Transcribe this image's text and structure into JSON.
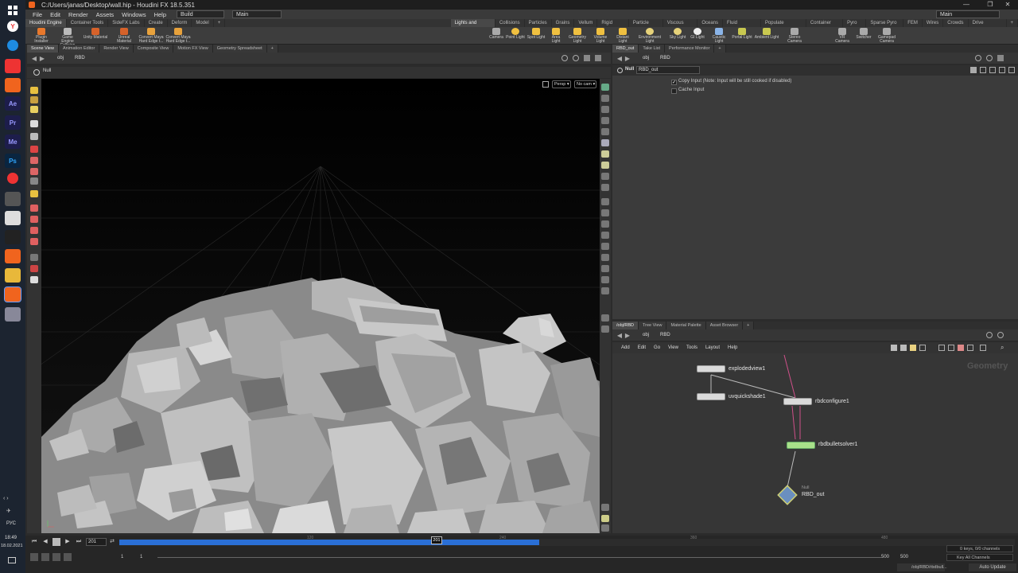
{
  "window": {
    "title": "C:/Users/janas/Desktop/wall.hip - Houdini FX 18.5.351"
  },
  "menubar": {
    "items": [
      "File",
      "Edit",
      "Render",
      "Assets",
      "Windows",
      "Help"
    ],
    "desktop_dropdown": "Build",
    "right_dropdown": "Main",
    "right_dropdown2": "Main"
  },
  "shelf_tabs_left": [
    "Houdini Engine",
    "Container Tools",
    "SideFX Labs",
    "Create",
    "Deform",
    "Model"
  ],
  "shelf_tabs_right": [
    "Lights and Cameras",
    "Collisions",
    "Particles",
    "Grains",
    "Vellum",
    "Rigid Bodies",
    "Particle Fluids",
    "Viscous Fluids",
    "Oceans",
    "Fluid Containers",
    "Populate Containers",
    "Container Tools",
    "Pyro FX",
    "Sparse Pyro FX",
    "FEM",
    "Wires",
    "Crowds",
    "Drive Simulation"
  ],
  "shelf_tools_left": [
    "Plugin Installer",
    "Game Engine Collision",
    "Unity Material",
    "Unreal Material",
    "Convert Maya Hard Edge t...",
    "Convert Maya Hard Edge t..."
  ],
  "shelf_tools_right": [
    "Camera",
    "Point Light",
    "Spot Light",
    "Area Light",
    "Geometry Light",
    "Volume Light",
    "Distant Light",
    "Environment Light",
    "Sky Light",
    "GI Light",
    "Caustic Light",
    "Portal Light",
    "Ambient Light",
    "Stereo Camera",
    "VR Camera",
    "Switcher",
    "Gamepad Camera"
  ],
  "left_pane": {
    "tabs": [
      "Scene View",
      "Animation Editor",
      "Render View",
      "Composite View",
      "Motion FX View",
      "Geometry Spreadsheet"
    ],
    "path": [
      "obj",
      "RBD"
    ],
    "null_label": "Null",
    "view_persp": "Persp",
    "view_cam": "No cam"
  },
  "right_top": {
    "tabs": [
      "RBD_out",
      "Take List",
      "Performance Monitor"
    ],
    "path": [
      "obj",
      "RBD"
    ],
    "node_type": "Null",
    "node_name": "RBD_out",
    "params": [
      {
        "label": "Copy Input (Note: Input will be still cooked if disabled)",
        "checked": true
      },
      {
        "label": "Cache Input",
        "checked": false
      }
    ]
  },
  "network": {
    "tabs": [
      "/obj/RBD",
      "Tree View",
      "Material Palette",
      "Asset Browser"
    ],
    "path": [
      "obj",
      "RBD"
    ],
    "menu": [
      "Add",
      "Edit",
      "Go",
      "View",
      "Tools",
      "Layout",
      "Help"
    ],
    "context_label": "Geometry",
    "nodes": [
      {
        "name": "explodedview1"
      },
      {
        "name": "uvquickshade1"
      },
      {
        "name": "rbdconfigure1"
      },
      {
        "name": "rbdbulletsolver1"
      },
      {
        "name": "RBD_out",
        "type": "Null"
      }
    ]
  },
  "timeline": {
    "current_frame": "201",
    "marker_frame": "201",
    "ticks": [
      "120",
      "240",
      "360",
      "480"
    ],
    "start": "1",
    "start2": "1",
    "end": "500",
    "end2": "500",
    "keys_info": "0 keys, 0/0 channels",
    "key_all": "Key All Channels",
    "auto_update": "Auto Update",
    "status_path": "/obj/RBD/rbdbull..."
  },
  "taskbar": {
    "time": "18:49",
    "date": "18.02.2021",
    "lang": "РУС"
  },
  "colors": {
    "accent_blue": "#2a6fd6",
    "solver_green": "#a8e08a"
  }
}
